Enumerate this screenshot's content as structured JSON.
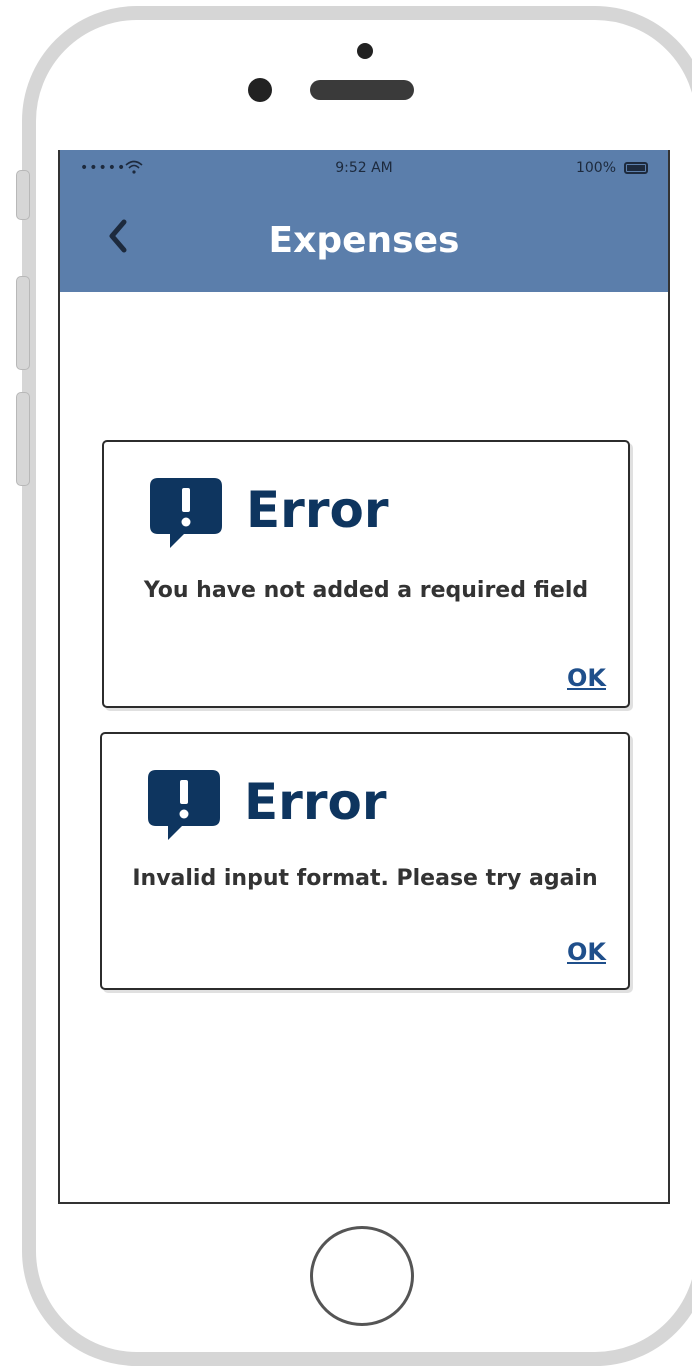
{
  "status_bar": {
    "signal": "•••••",
    "time": "9:52 AM",
    "battery": "100%"
  },
  "header": {
    "title": "Expenses",
    "back_icon": "chevron-left-icon"
  },
  "dialogs": [
    {
      "icon": "alert-speech-bubble-icon",
      "title": "Error",
      "message": "You have not added a required field",
      "action": "OK"
    },
    {
      "icon": "alert-speech-bubble-icon",
      "title": "Error",
      "message": "Invalid input format. Please try again",
      "action": "OK"
    }
  ],
  "colors": {
    "header_bg": "#5b7eab",
    "error_title": "#0e355f",
    "link": "#1f4f8b"
  }
}
